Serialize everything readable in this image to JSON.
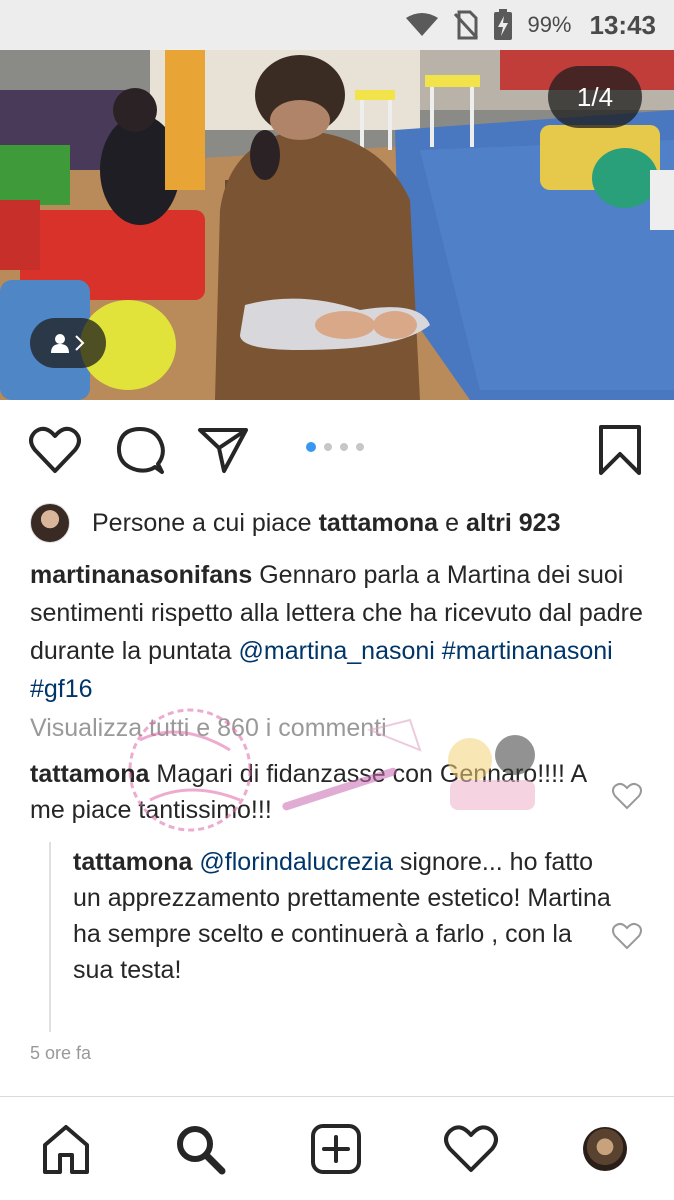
{
  "status_bar": {
    "icons": [
      "wifi-icon",
      "no-sim-icon",
      "battery-charging-icon"
    ],
    "battery_percent": "99%",
    "time": "13:43"
  },
  "post": {
    "image_counter": "1/4",
    "carousel": {
      "total": 4,
      "active": 1
    },
    "tag_badge_icons": [
      "person-icon",
      "chevron-right-icon"
    ],
    "actions": [
      "heart-icon",
      "comment-icon",
      "share-icon",
      "bookmark-icon"
    ],
    "likes": {
      "prefix": "Persone a cui piace",
      "user": "tattamona",
      "connector": "e",
      "others": "altri 923"
    },
    "caption": {
      "user": "martinanasonifans",
      "text": "Gennaro parla a Martina dei suoi sentimenti rispetto alla lettera che ha ricevuto dal padre durante la puntata",
      "mention": "@martina_nasoni",
      "tags": [
        "#martinanasoni",
        "#gf16"
      ]
    },
    "view_all": "Visualizza tutti e 860 i commenti",
    "comments": [
      {
        "user": "tattamona",
        "text": "Magari di fidanzasse con Gennaro!!!! A me piace tantissimo!!!"
      },
      {
        "user": "tattamona",
        "mention": "@florindalucrezia",
        "text": "signore... ho fatto un apprezzamento prettamente estetico! Martina ha sempre scelto e continuerà a farlo , con la sua testa!"
      }
    ],
    "timestamp": "5 ore fa"
  },
  "bottom_nav": [
    "home-icon",
    "search-icon",
    "add-post-icon",
    "activity-heart-icon",
    "profile-avatar"
  ],
  "colors": {
    "link": "#003569",
    "muted": "#999999",
    "dot_active": "#3897f0",
    "dot_inactive": "#c7c7c7",
    "text": "#262626"
  }
}
